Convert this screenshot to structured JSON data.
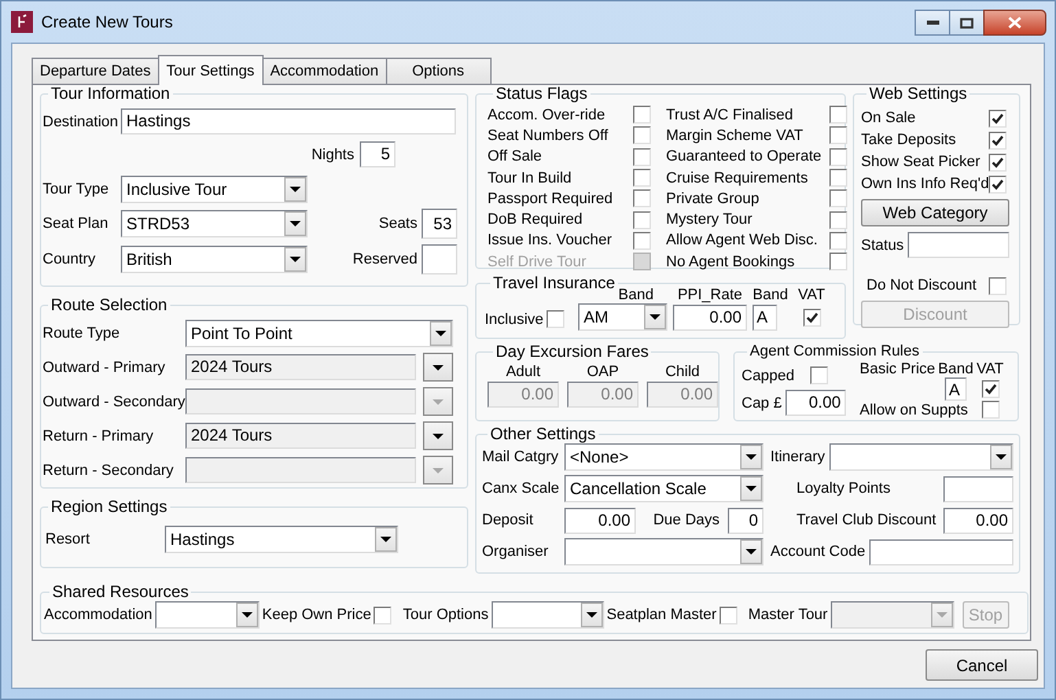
{
  "window": {
    "title": "Create New Tours"
  },
  "tabs": [
    {
      "label": "Departure Dates",
      "selected": false
    },
    {
      "label": "Tour Settings",
      "selected": true
    },
    {
      "label": "Accommodation",
      "selected": false
    },
    {
      "label": "Options",
      "selected": false
    }
  ],
  "tour_information": {
    "title": "Tour Information",
    "destination": {
      "label": "Destination",
      "value": "Hastings"
    },
    "nights": {
      "label": "Nights",
      "value": "5"
    },
    "tour_type": {
      "label": "Tour Type",
      "value": "Inclusive Tour"
    },
    "seat_plan": {
      "label": "Seat Plan",
      "value": "STRD53"
    },
    "country": {
      "label": "Country",
      "value": "British"
    },
    "seats": {
      "label": "Seats",
      "value": "53"
    },
    "reserved": {
      "label": "Reserved"
    }
  },
  "route_selection": {
    "title": "Route Selection",
    "rows": [
      {
        "label": "Route Type",
        "value": "Point To Point",
        "kind": "combo",
        "disabled": false
      },
      {
        "label": "Outward - Primary",
        "value": "2024 Tours",
        "kind": "picker",
        "disabled": false
      },
      {
        "label": "Outward - Secondary",
        "kind": "picker",
        "disabled": true
      },
      {
        "label": "Return - Primary",
        "value": "2024 Tours",
        "kind": "picker",
        "disabled": false
      },
      {
        "label": "Return - Secondary",
        "kind": "picker",
        "disabled": true
      }
    ]
  },
  "region_settings": {
    "title": "Region Settings",
    "resort": {
      "label": "Resort",
      "value": "Hastings"
    }
  },
  "status_flags": {
    "title": "Status Flags",
    "flags": [
      {
        "label": "Accom. Over-ride",
        "checked": false,
        "disabled": false
      },
      {
        "label": "Seat Numbers Off",
        "checked": false,
        "disabled": false
      },
      {
        "label": "Off Sale",
        "checked": false,
        "disabled": false
      },
      {
        "label": "Tour In Build",
        "checked": false,
        "disabled": false
      },
      {
        "label": "Passport Required",
        "checked": false,
        "disabled": false
      },
      {
        "label": "DoB Required",
        "checked": false,
        "disabled": false
      },
      {
        "label": "Issue Ins. Voucher",
        "checked": false,
        "disabled": false
      },
      {
        "label": "Self Drive Tour",
        "checked": false,
        "disabled": true
      },
      {
        "label": "Trust A/C Finalised",
        "checked": false,
        "disabled": false
      },
      {
        "label": "Margin Scheme VAT",
        "checked": false,
        "disabled": false
      },
      {
        "label": "Guaranteed to Operate",
        "checked": false,
        "disabled": false
      },
      {
        "label": "Cruise Requirements",
        "checked": false,
        "disabled": false
      },
      {
        "label": "Private Group",
        "checked": false,
        "disabled": false
      },
      {
        "label": "Mystery Tour",
        "checked": false,
        "disabled": false
      },
      {
        "label": "Allow Agent Web Disc.",
        "checked": false,
        "disabled": false
      },
      {
        "label": "No Agent Bookings",
        "checked": false,
        "disabled": false
      }
    ]
  },
  "web_settings": {
    "title": "Web Settings",
    "options": [
      {
        "label": "On Sale",
        "checked": true
      },
      {
        "label": "Take Deposits",
        "checked": true
      },
      {
        "label": "Show Seat Picker",
        "checked": true
      },
      {
        "label": "Own Ins Info Req'd",
        "checked": true
      }
    ],
    "web_category_button": {
      "label": "Web Category",
      "disabled": false
    },
    "status": {
      "label": "Status"
    },
    "do_not_discount": {
      "label": "Do Not Discount",
      "checked": false
    },
    "discount_button": {
      "label": "Discount",
      "disabled": true
    }
  },
  "travel_insurance": {
    "title": "Travel Insurance",
    "band_heading": "Band",
    "ppi_rate_heading": "PPI_Rate",
    "vat_band_heading": "Band",
    "vat_heading": "VAT",
    "inclusive": {
      "label": "Inclusive",
      "checked": false
    },
    "band": "AM",
    "ppi_rate": "0.00",
    "vat_band": "A",
    "vat": true
  },
  "day_excursion_fares": {
    "title": "Day Excursion Fares",
    "fares": [
      {
        "label": "Adult",
        "value": "0.00",
        "disabled": true
      },
      {
        "label": "OAP",
        "value": "0.00",
        "disabled": true
      },
      {
        "label": "Child",
        "value": "0.00",
        "disabled": true
      }
    ]
  },
  "agent_commission_rules": {
    "title": "Agent Commission Rules",
    "capped": {
      "label": "Capped",
      "checked": false
    },
    "cap": {
      "label": "Cap £",
      "value": "0.00"
    },
    "band_heading": "Band",
    "vat_heading": "VAT",
    "basic_price": {
      "label": "Basic Price",
      "band": "A",
      "vat": true
    },
    "allow_on_suppts": {
      "label": "Allow on Suppts",
      "checked": false
    }
  },
  "other_settings": {
    "title": "Other Settings",
    "mail_category": {
      "label": "Mail Catgry",
      "value": "<None>"
    },
    "itinerary": {
      "label": "Itinerary"
    },
    "canx_scale": {
      "label": "Canx Scale",
      "value": "Cancellation Scale"
    },
    "loyalty_points": {
      "label": "Loyalty Points"
    },
    "deposit": {
      "label": "Deposit",
      "value": "0.00"
    },
    "due_days": {
      "label": "Due Days",
      "value": "0"
    },
    "travel_club_discount": {
      "label": "Travel Club Discount",
      "value": "0.00"
    },
    "organiser": {
      "label": "Organiser"
    },
    "account_code": {
      "label": "Account Code"
    }
  },
  "shared_resources": {
    "title": "Shared Resources",
    "accommodation": {
      "label": "Accommodation"
    },
    "keep_own_price": {
      "label": "Keep Own Price",
      "checked": false
    },
    "tour_options": {
      "label": "Tour Options"
    },
    "seatplan_master": {
      "label": "Seatplan Master",
      "checked": false
    },
    "master_tour": {
      "label": "Master Tour",
      "disabled": true
    },
    "stop_button": {
      "label": "Stop",
      "disabled": true
    }
  },
  "buttons": [
    {
      "label": "Cancel",
      "disabled": false
    }
  ]
}
